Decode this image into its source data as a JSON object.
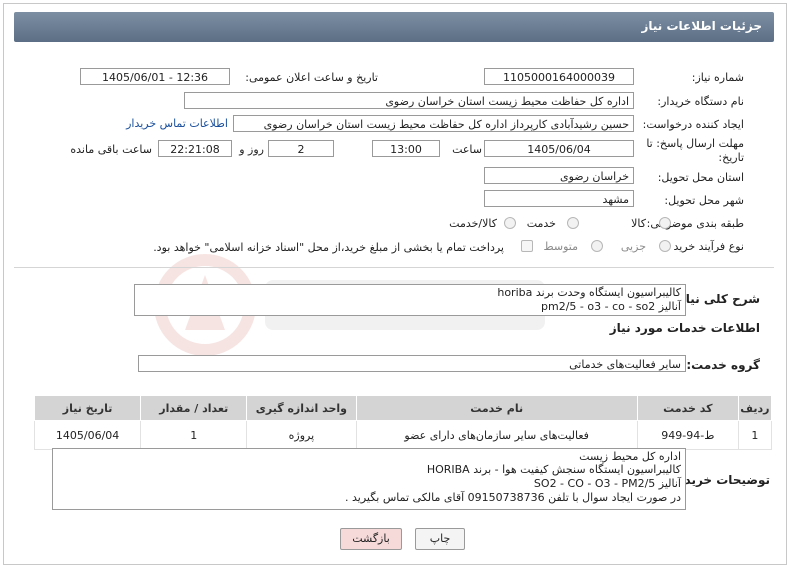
{
  "page_title": "جزئیات اطلاعات نیاز",
  "fields": {
    "need_number_label": "شماره نیاز:",
    "need_number": "1105000164000039",
    "announce_label": "تاریخ و ساعت اعلان عمومی:",
    "announce_value": "1405/06/01 - 12:36",
    "buyer_org_label": "نام دستگاه خریدار:",
    "buyer_org": "اداره کل حفاظت محیط زیست استان خراسان رضوی",
    "creator_label": "ایجاد کننده درخواست:",
    "creator": "حسین رشیدآبادی کارپرداز اداره کل حفاظت محیط زیست استان خراسان رضوی",
    "contact_link": "اطلاعات تماس خریدار",
    "deadline_label_1": "مهلت ارسال پاسخ: تا",
    "deadline_label_2": "تاریخ:",
    "deadline_date": "1405/06/04",
    "time_label": "ساعت",
    "deadline_time": "13:00",
    "days_value": "2",
    "days_label": "روز و",
    "remaining_time": "22:21:08",
    "remaining_label": "ساعت باقی مانده",
    "province_label": "استان محل تحویل:",
    "province": "خراسان رضوی",
    "city_label": "شهر محل تحویل:",
    "city": "مشهد",
    "category_label": "طبقه بندی موضوعی:",
    "category_options": [
      "کالا",
      "خدمت",
      "کالا/خدمت"
    ],
    "purchase_label": "نوع فرآیند خرید :",
    "purchase_options": [
      "جزیی",
      "متوسط"
    ],
    "payment_note": "پرداخت تمام یا بخشی از مبلغ خرید،از محل \"اسناد خزانه اسلامی\" خواهد بود."
  },
  "summary": {
    "label": "شرح کلی نیاز:",
    "line1": "کالیبراسیون ایستگاه وحدت برند horiba",
    "line2": "آنالیز pm2/5 - o3 - co - so2"
  },
  "services_header": "اطلاعات خدمات مورد نیاز",
  "service_group": {
    "label": "گروه خدمت:",
    "value": "سایر فعالیت‌های خدماتی"
  },
  "table": {
    "headers": [
      "ردیف",
      "کد خدمت",
      "نام خدمت",
      "واحد اندازه گیری",
      "تعداد / مقدار",
      "تاریخ نیاز"
    ],
    "rows": [
      [
        "1",
        "ط-94-949",
        "فعالیت‌های سایر سازمان‌های دارای عضو",
        "پروژه",
        "1",
        "1405/06/04"
      ]
    ]
  },
  "buyer_notes": {
    "label": "توضیحات خریدار:",
    "lines": [
      "اداره کل محیط زیست",
      "کالیبراسیون ایستگاه سنجش کیفیت هوا - برند HORIBA",
      "آنالیز SO2 - CO - O3 - PM2/5",
      "در صورت ایجاد سوال با تلفن 09150738736 آقای مالکی تماس بگیرید ."
    ]
  },
  "buttons": {
    "print": "چاپ",
    "back": "بازگشت"
  },
  "colors": {
    "title_bar": "#6a7d94",
    "back_button": "#f6d9d9",
    "link": "#1a4f9c"
  }
}
